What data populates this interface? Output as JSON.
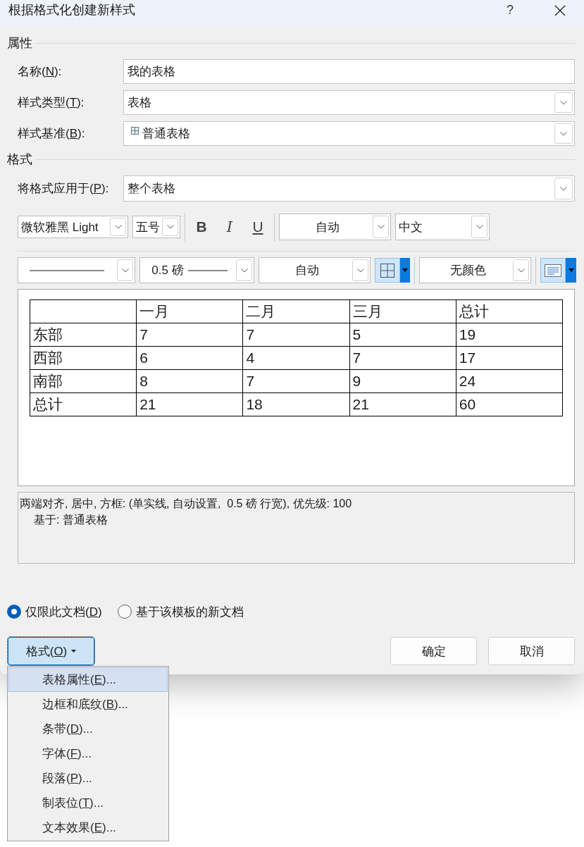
{
  "window": {
    "title": "根据格式化创建新样式",
    "help": "?"
  },
  "properties": {
    "heading": "属性",
    "fields": [
      {
        "kind": "text",
        "label": "名称(N):",
        "mnemonic": true,
        "value": "我的表格"
      },
      {
        "kind": "dropdown",
        "label": "样式类型(T):",
        "mnemonic": true,
        "value": "表格"
      },
      {
        "kind": "style_dropdown",
        "label": "样式基准(B):",
        "mnemonic": true,
        "value": "普通表格"
      }
    ]
  },
  "formatting": {
    "heading": "格式",
    "apply_to": {
      "kind": "dropdown",
      "label": "将格式应用于(P):",
      "mnemonic": true,
      "value": "整个表格"
    },
    "font_toolbar": [
      {
        "kind": "font",
        "value": "微软雅黑 Light"
      },
      {
        "kind": "size",
        "value": "五号"
      },
      {
        "kind": "separator"
      },
      {
        "kind": "bold",
        "text": "B"
      },
      {
        "kind": "italic",
        "text": "I"
      },
      {
        "kind": "underline",
        "text": "U"
      },
      {
        "kind": "separator"
      },
      {
        "kind": "font_color",
        "value": "自动"
      },
      {
        "kind": "language",
        "value": "中文"
      }
    ],
    "border_toolbar": [
      {
        "kind": "line_style"
      },
      {
        "kind": "line_width",
        "value": "0.5 磅"
      },
      {
        "kind": "border_color",
        "value": "自动"
      },
      {
        "kind": "borders"
      },
      {
        "kind": "separator"
      },
      {
        "kind": "shading",
        "value": "无颜色"
      },
      {
        "kind": "separator"
      },
      {
        "kind": "alignment"
      }
    ]
  },
  "preview": {
    "columns": [
      "一月",
      "二月",
      "三月",
      "总计"
    ],
    "rows": [
      {
        "label": "东部",
        "cells": [
          "7",
          "7",
          "5",
          "19"
        ]
      },
      {
        "label": "西部",
        "cells": [
          "6",
          "4",
          "7",
          "17"
        ]
      },
      {
        "label": "南部",
        "cells": [
          "8",
          "7",
          "9",
          "24"
        ]
      },
      {
        "label": "总计",
        "cells": [
          "21",
          "18",
          "21",
          "60"
        ]
      }
    ]
  },
  "description": {
    "summary": "两端对齐, 居中, 方框: (单实线, 自动设置,  0.5 磅 行宽), 优先级: 100",
    "based_on": "基于: 普通表格"
  },
  "scope": [
    {
      "label": "仅限此文档(D)",
      "mnemonic": true,
      "selected": true
    },
    {
      "label": "基于该模板的新文档",
      "selected": false
    }
  ],
  "buttons": [
    {
      "kind": "menu_button",
      "label": "格式(O)",
      "mnemonic": true,
      "expanded": true
    },
    {
      "kind": "push",
      "label": "确定"
    },
    {
      "kind": "push",
      "label": "取消"
    }
  ],
  "format_menu": [
    {
      "label": "表格属性(E)...",
      "mnemonic": true,
      "selected": true
    },
    {
      "label": "边框和底纹(B)...",
      "mnemonic": true,
      "selected": false
    },
    {
      "label": "条带(D)...",
      "mnemonic": true,
      "selected": false
    },
    {
      "label": "字体(F)...",
      "mnemonic": true,
      "selected": false
    },
    {
      "label": "段落(P)...",
      "mnemonic": true,
      "selected": false
    },
    {
      "label": "制表位(T)...",
      "mnemonic": true,
      "selected": false
    },
    {
      "label": "文本效果(E)...",
      "mnemonic": true,
      "selected": false
    }
  ]
}
